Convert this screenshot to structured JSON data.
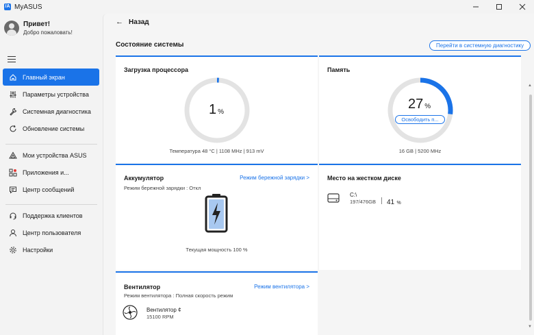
{
  "app": {
    "title": "MyASUS",
    "logo": "/A"
  },
  "profile": {
    "name": "Привет!",
    "subtitle": "Добро пожаловать!"
  },
  "nav": {
    "group1": [
      {
        "label": "Главный экран",
        "icon": "home-icon",
        "active": true
      },
      {
        "label": "Параметры устройства",
        "icon": "sliders-icon"
      },
      {
        "label": "Системная диагностика",
        "icon": "wrench-icon"
      },
      {
        "label": "Обновление системы",
        "icon": "refresh-icon"
      }
    ],
    "group2": [
      {
        "label": "Мои устройства ASUS",
        "icon": "triangle-icon"
      },
      {
        "label": "Приложения и...",
        "icon": "apps-icon"
      },
      {
        "label": "Центр сообщений",
        "icon": "message-icon"
      }
    ],
    "group3": [
      {
        "label": "Поддержка клиентов",
        "icon": "headset-icon"
      },
      {
        "label": "Центр пользователя",
        "icon": "user-icon"
      },
      {
        "label": "Настройки",
        "icon": "gear-icon"
      }
    ]
  },
  "header": {
    "back_label": "Назад"
  },
  "system": {
    "title": "Состояние системы",
    "diag_button": "Перейти в системную диагностику"
  },
  "cpu": {
    "title": "Загрузка процессора",
    "value": "1",
    "unit": "%",
    "percent": 1,
    "footer": "Температура 48 °C  |  1108 MHz  |  913 mV"
  },
  "memory": {
    "title": "Память",
    "value": "27",
    "unit": "%",
    "percent": 27,
    "free_button": "Освободить п...",
    "footer": "16 GB  |  5200 MHz"
  },
  "battery": {
    "title": "Аккумулятор",
    "link": "Режим бережной зарядки >",
    "subtitle": "Режим бережной зарядки : Откл",
    "footer": "Текущая мощность 100 %",
    "level_percent": 100
  },
  "disk": {
    "title": "Место на жестком диске",
    "drive": "C:\\",
    "usage": "197/476GB",
    "percent_value": "41",
    "percent_unit": "%"
  },
  "fan": {
    "title": "Вентилятор",
    "link": "Режим вентилятора >",
    "subtitle": "Режим вентилятора : Полная скорость режим",
    "name": "Вентилятор ¢",
    "rpm": "15100 RPM"
  },
  "colors": {
    "accent": "#1a73e8",
    "gauge_track": "#e3e3e3"
  }
}
